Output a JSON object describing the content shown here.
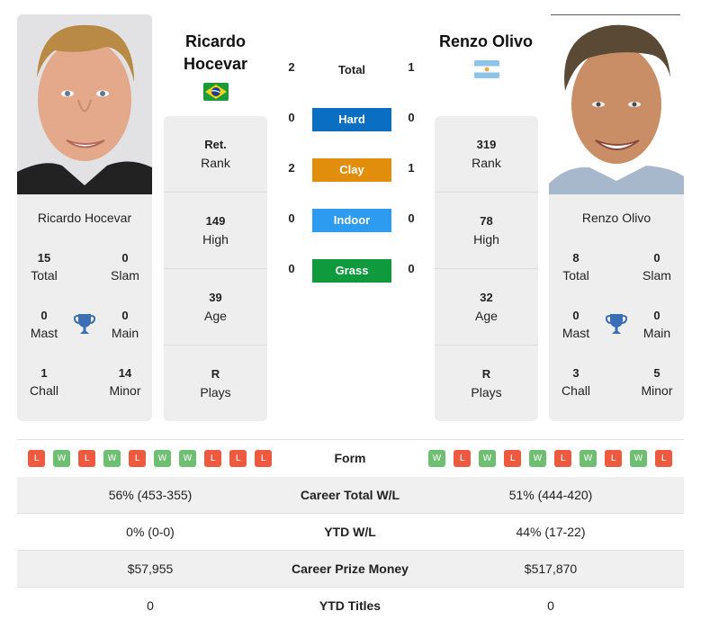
{
  "player1": {
    "name": "Ricardo Hocevar",
    "name_line1": "Ricardo",
    "name_line2": "Hocevar",
    "country_flag": "brazil-flag",
    "photo": "player-photo",
    "rank": {
      "value": "Ret.",
      "label": "Rank"
    },
    "high": {
      "value": "149",
      "label": "High"
    },
    "age": {
      "value": "39",
      "label": "Age"
    },
    "plays": {
      "value": "R",
      "label": "Plays"
    },
    "titles": {
      "total": {
        "value": "15",
        "label": "Total"
      },
      "slam": {
        "value": "0",
        "label": "Slam"
      },
      "mast": {
        "value": "0",
        "label": "Mast"
      },
      "main": {
        "value": "0",
        "label": "Main"
      },
      "chall": {
        "value": "1",
        "label": "Chall"
      },
      "minor": {
        "value": "14",
        "label": "Minor"
      }
    },
    "form": [
      "L",
      "W",
      "L",
      "W",
      "L",
      "W",
      "W",
      "L",
      "L",
      "L"
    ]
  },
  "player2": {
    "name": "Renzo Olivo",
    "country_flag": "argentina-flag",
    "photo": "player-photo",
    "rank": {
      "value": "319",
      "label": "Rank"
    },
    "high": {
      "value": "78",
      "label": "High"
    },
    "age": {
      "value": "32",
      "label": "Age"
    },
    "plays": {
      "value": "R",
      "label": "Plays"
    },
    "titles": {
      "total": {
        "value": "8",
        "label": "Total"
      },
      "slam": {
        "value": "0",
        "label": "Slam"
      },
      "mast": {
        "value": "0",
        "label": "Mast"
      },
      "main": {
        "value": "0",
        "label": "Main"
      },
      "chall": {
        "value": "3",
        "label": "Chall"
      },
      "minor": {
        "value": "5",
        "label": "Minor"
      }
    },
    "form": [
      "W",
      "L",
      "W",
      "L",
      "W",
      "L",
      "W",
      "L",
      "W",
      "L"
    ]
  },
  "h2h": {
    "total": {
      "label": "Total",
      "p1": "2",
      "p2": "1"
    },
    "surfaces": [
      {
        "label": "Hard",
        "p1": "0",
        "p2": "0",
        "color": "#0a6ec3"
      },
      {
        "label": "Clay",
        "p1": "2",
        "p2": "1",
        "color": "#e08e0b"
      },
      {
        "label": "Indoor",
        "p1": "0",
        "p2": "0",
        "color": "#2d9cf0"
      },
      {
        "label": "Grass",
        "p1": "0",
        "p2": "0",
        "color": "#0f9a3d"
      }
    ]
  },
  "form_label": "Form",
  "stats": [
    {
      "label": "Career Total W/L",
      "p1": "56% (453-355)",
      "p2": "51% (444-420)"
    },
    {
      "label": "YTD W/L",
      "p1": "0% (0-0)",
      "p2": "44% (17-22)"
    },
    {
      "label": "Career Prize Money",
      "p1": "$57,955",
      "p2": "$517,870"
    },
    {
      "label": "YTD Titles",
      "p1": "0",
      "p2": "0"
    }
  ]
}
